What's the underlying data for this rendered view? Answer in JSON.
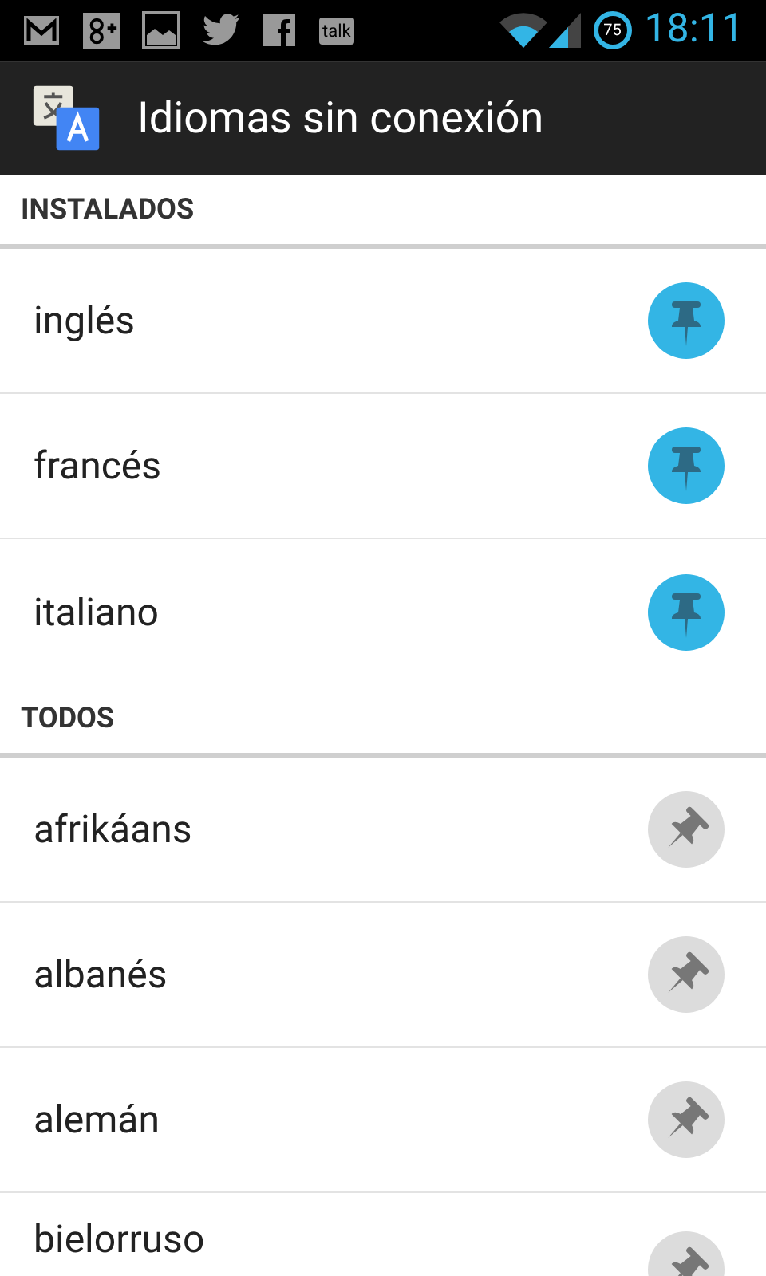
{
  "status_bar": {
    "notifications": [
      {
        "kind": "mail"
      },
      {
        "kind": "gplus"
      },
      {
        "kind": "gallery"
      },
      {
        "kind": "twitter"
      },
      {
        "kind": "facebook"
      },
      {
        "kind": "talk",
        "label": "talk"
      }
    ],
    "battery": "75",
    "time": "18:11"
  },
  "app_bar": {
    "title": "Idiomas sin conexión"
  },
  "sections": [
    {
      "title": "INSTALADOS",
      "items": [
        {
          "label": "inglés",
          "pinned": true
        },
        {
          "label": "francés",
          "pinned": true
        },
        {
          "label": "italiano",
          "pinned": true
        }
      ]
    },
    {
      "title": "TODOS",
      "items": [
        {
          "label": "afrikáans",
          "pinned": false
        },
        {
          "label": "albanés",
          "pinned": false
        },
        {
          "label": "alemán",
          "pinned": false
        },
        {
          "label": "bielorruso",
          "pinned": false
        }
      ]
    }
  ]
}
